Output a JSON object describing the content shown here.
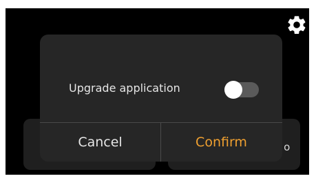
{
  "dialog": {
    "toggle_label": "Upgrade application",
    "toggle_on": false,
    "cancel_label": "Cancel",
    "confirm_label": "Confirm"
  },
  "background": {
    "partial_text": "ıo"
  },
  "icons": {
    "settings": "gear-icon"
  },
  "colors": {
    "screen_bg": "#000000",
    "dialog_bg": "#262626",
    "confirm_accent": "#f0a030",
    "toggle_track": "#5a5a5a",
    "toggle_knob": "#ffffff"
  }
}
